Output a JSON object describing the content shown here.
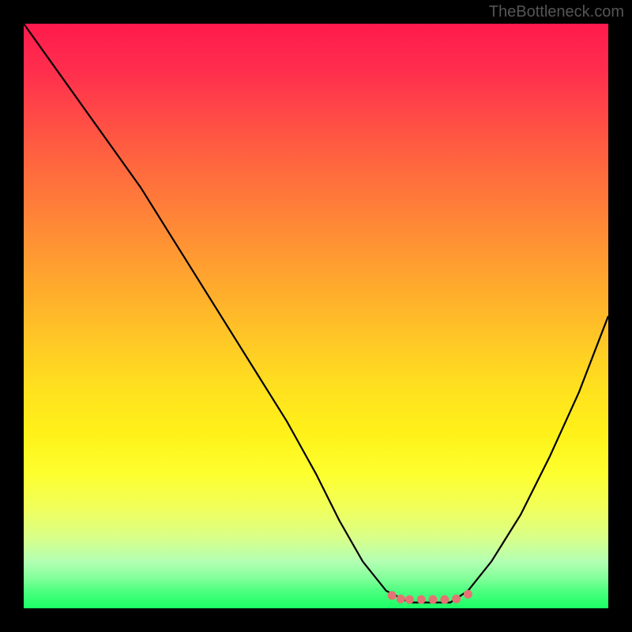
{
  "watermark": "TheBottleneck.com",
  "chart_data": {
    "type": "line",
    "title": "",
    "xlabel": "",
    "ylabel": "",
    "xlim": [
      0,
      100
    ],
    "ylim": [
      0,
      100
    ],
    "curve_points": {
      "x": [
        0,
        5,
        10,
        15,
        20,
        25,
        30,
        35,
        40,
        45,
        50,
        54,
        58,
        62,
        66,
        70,
        73,
        76,
        80,
        85,
        90,
        95,
        100
      ],
      "y": [
        100,
        93,
        86,
        79,
        72,
        64,
        56,
        48,
        40,
        32,
        23,
        15,
        8,
        3,
        1,
        1,
        1,
        3,
        8,
        16,
        26,
        37,
        50
      ]
    },
    "flat_zone": {
      "x_start": 63,
      "x_end": 76,
      "y": 1.5,
      "markers": [
        {
          "x": 63,
          "y": 2.2
        },
        {
          "x": 64.5,
          "y": 1.6
        },
        {
          "x": 66,
          "y": 1.5
        },
        {
          "x": 68,
          "y": 1.5
        },
        {
          "x": 70,
          "y": 1.5
        },
        {
          "x": 72,
          "y": 1.5
        },
        {
          "x": 74,
          "y": 1.6
        },
        {
          "x": 76,
          "y": 2.4
        }
      ]
    },
    "gradient_colors": {
      "top": "#ff1a4d",
      "mid": "#ffe01f",
      "bottom": "#1aff66"
    },
    "curve_color": "#000000",
    "marker_color": "#e57373"
  }
}
